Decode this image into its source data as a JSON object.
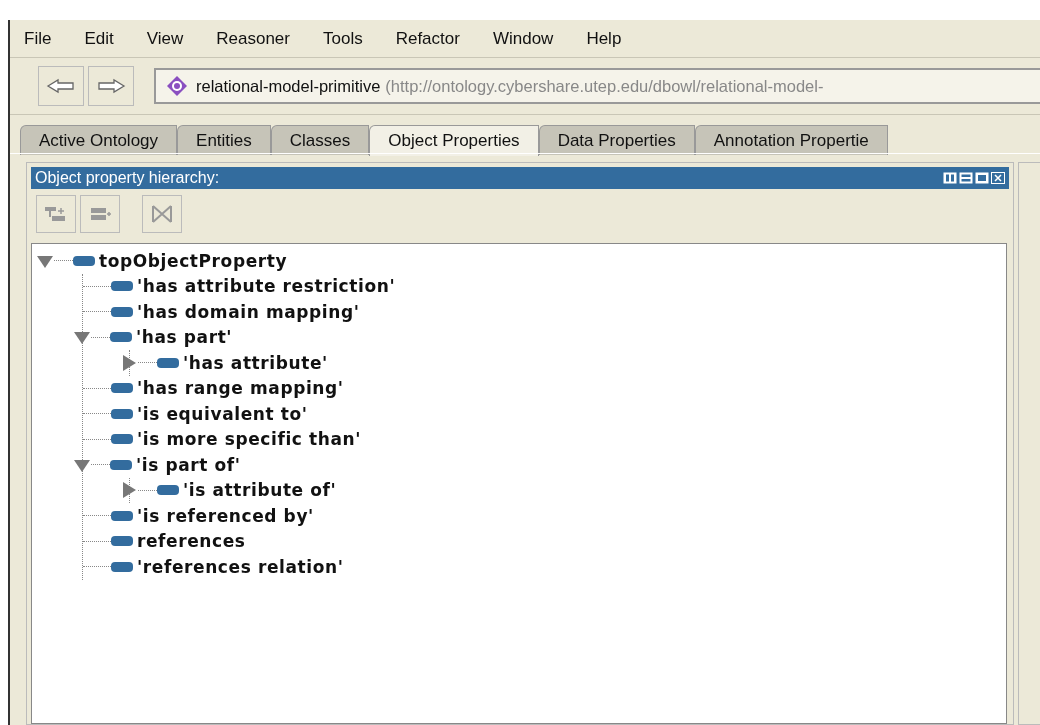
{
  "menu": [
    "File",
    "Edit",
    "View",
    "Reasoner",
    "Tools",
    "Refactor",
    "Window",
    "Help"
  ],
  "address": {
    "name": "relational-model-primitive",
    "iri": "(http://ontology.cybershare.utep.edu/dbowl/relational-model-"
  },
  "tabs": [
    {
      "label": "Active Ontology",
      "selected": false
    },
    {
      "label": "Entities",
      "selected": false
    },
    {
      "label": "Classes",
      "selected": false
    },
    {
      "label": "Object Properties",
      "selected": true
    },
    {
      "label": "Data Properties",
      "selected": false
    },
    {
      "label": "Annotation Propertie",
      "selected": false
    }
  ],
  "panel": {
    "title": "Object property hierarchy:"
  },
  "tree": [
    {
      "label": "topObjectProperty",
      "expanded": true,
      "children": [
        {
          "label": "'has attribute restriction'"
        },
        {
          "label": "'has domain mapping'"
        },
        {
          "label": "'has part'",
          "expanded": true,
          "children": [
            {
              "label": "'has attribute'",
              "expanded": false
            }
          ]
        },
        {
          "label": "'has range mapping'"
        },
        {
          "label": "'is equivalent to'"
        },
        {
          "label": "'is more specific than'"
        },
        {
          "label": "'is part of'",
          "expanded": true,
          "children": [
            {
              "label": "'is attribute of'",
              "expanded": false
            }
          ]
        },
        {
          "label": "'is referenced by'"
        },
        {
          "label": "references"
        },
        {
          "label": "'references relation'"
        }
      ]
    }
  ]
}
